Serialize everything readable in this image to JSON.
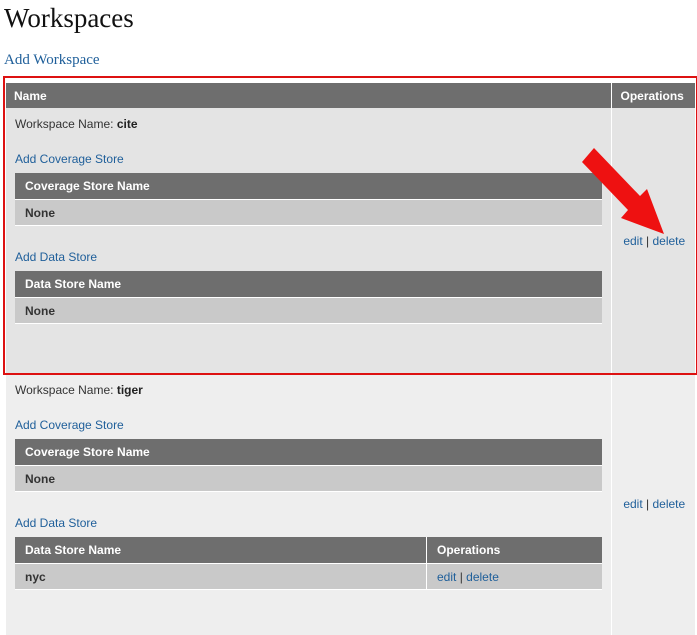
{
  "page": {
    "title": "Workspaces",
    "add_workspace_label": "Add Workspace"
  },
  "table": {
    "col_name": "Name",
    "col_operations": "Operations"
  },
  "workspaces": [
    {
      "label_prefix": "Workspace Name:",
      "name": "cite",
      "add_coverage_store_label": "Add Coverage Store",
      "coverage_store_header": "Coverage Store Name",
      "coverage_store_value": "None",
      "add_data_store_label": "Add Data Store",
      "data_store_header": "Data Store Name",
      "data_store_value": "None",
      "edit_label": "edit",
      "separator": "|",
      "delete_label": "delete"
    },
    {
      "label_prefix": "Workspace Name:",
      "name": "tiger",
      "add_coverage_store_label": "Add Coverage Store",
      "coverage_store_header": "Coverage Store Name",
      "coverage_store_value": "None",
      "add_data_store_label": "Add Data Store",
      "data_store_header": "Data Store Name",
      "data_store_operations_header": "Operations",
      "data_store_value": "nyc",
      "data_store_edit_label": "edit",
      "data_store_delete_label": "delete",
      "edit_label": "edit",
      "separator": "|",
      "delete_label": "delete"
    }
  ],
  "annotation": {
    "highlight_color": "#dd1111",
    "arrow_color": "#ee1111"
  },
  "colors": {
    "link": "#1f5f9a",
    "header_bg": "#6e6e6e",
    "row_odd_bg": "#e4e4e4",
    "row_even_bg": "#eeeeee",
    "inner_cell_bg": "#c9c9c9"
  }
}
